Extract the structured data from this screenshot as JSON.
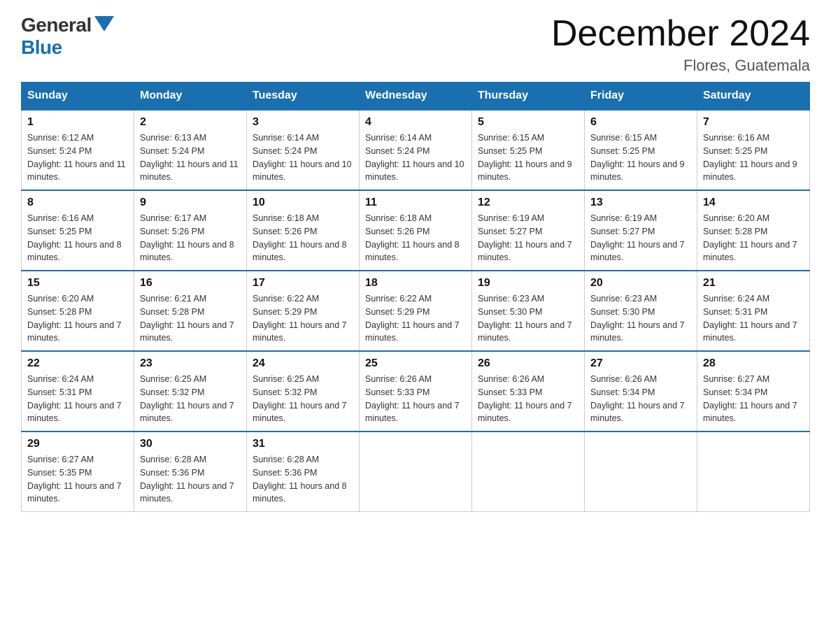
{
  "header": {
    "logo_general": "General",
    "logo_blue": "Blue",
    "month_year": "December 2024",
    "location": "Flores, Guatemala"
  },
  "weekdays": [
    "Sunday",
    "Monday",
    "Tuesday",
    "Wednesday",
    "Thursday",
    "Friday",
    "Saturday"
  ],
  "weeks": [
    [
      {
        "day": "1",
        "sunrise": "6:12 AM",
        "sunset": "5:24 PM",
        "daylight": "11 hours and 11 minutes."
      },
      {
        "day": "2",
        "sunrise": "6:13 AM",
        "sunset": "5:24 PM",
        "daylight": "11 hours and 11 minutes."
      },
      {
        "day": "3",
        "sunrise": "6:14 AM",
        "sunset": "5:24 PM",
        "daylight": "11 hours and 10 minutes."
      },
      {
        "day": "4",
        "sunrise": "6:14 AM",
        "sunset": "5:24 PM",
        "daylight": "11 hours and 10 minutes."
      },
      {
        "day": "5",
        "sunrise": "6:15 AM",
        "sunset": "5:25 PM",
        "daylight": "11 hours and 9 minutes."
      },
      {
        "day": "6",
        "sunrise": "6:15 AM",
        "sunset": "5:25 PM",
        "daylight": "11 hours and 9 minutes."
      },
      {
        "day": "7",
        "sunrise": "6:16 AM",
        "sunset": "5:25 PM",
        "daylight": "11 hours and 9 minutes."
      }
    ],
    [
      {
        "day": "8",
        "sunrise": "6:16 AM",
        "sunset": "5:25 PM",
        "daylight": "11 hours and 8 minutes."
      },
      {
        "day": "9",
        "sunrise": "6:17 AM",
        "sunset": "5:26 PM",
        "daylight": "11 hours and 8 minutes."
      },
      {
        "day": "10",
        "sunrise": "6:18 AM",
        "sunset": "5:26 PM",
        "daylight": "11 hours and 8 minutes."
      },
      {
        "day": "11",
        "sunrise": "6:18 AM",
        "sunset": "5:26 PM",
        "daylight": "11 hours and 8 minutes."
      },
      {
        "day": "12",
        "sunrise": "6:19 AM",
        "sunset": "5:27 PM",
        "daylight": "11 hours and 7 minutes."
      },
      {
        "day": "13",
        "sunrise": "6:19 AM",
        "sunset": "5:27 PM",
        "daylight": "11 hours and 7 minutes."
      },
      {
        "day": "14",
        "sunrise": "6:20 AM",
        "sunset": "5:28 PM",
        "daylight": "11 hours and 7 minutes."
      }
    ],
    [
      {
        "day": "15",
        "sunrise": "6:20 AM",
        "sunset": "5:28 PM",
        "daylight": "11 hours and 7 minutes."
      },
      {
        "day": "16",
        "sunrise": "6:21 AM",
        "sunset": "5:28 PM",
        "daylight": "11 hours and 7 minutes."
      },
      {
        "day": "17",
        "sunrise": "6:22 AM",
        "sunset": "5:29 PM",
        "daylight": "11 hours and 7 minutes."
      },
      {
        "day": "18",
        "sunrise": "6:22 AM",
        "sunset": "5:29 PM",
        "daylight": "11 hours and 7 minutes."
      },
      {
        "day": "19",
        "sunrise": "6:23 AM",
        "sunset": "5:30 PM",
        "daylight": "11 hours and 7 minutes."
      },
      {
        "day": "20",
        "sunrise": "6:23 AM",
        "sunset": "5:30 PM",
        "daylight": "11 hours and 7 minutes."
      },
      {
        "day": "21",
        "sunrise": "6:24 AM",
        "sunset": "5:31 PM",
        "daylight": "11 hours and 7 minutes."
      }
    ],
    [
      {
        "day": "22",
        "sunrise": "6:24 AM",
        "sunset": "5:31 PM",
        "daylight": "11 hours and 7 minutes."
      },
      {
        "day": "23",
        "sunrise": "6:25 AM",
        "sunset": "5:32 PM",
        "daylight": "11 hours and 7 minutes."
      },
      {
        "day": "24",
        "sunrise": "6:25 AM",
        "sunset": "5:32 PM",
        "daylight": "11 hours and 7 minutes."
      },
      {
        "day": "25",
        "sunrise": "6:26 AM",
        "sunset": "5:33 PM",
        "daylight": "11 hours and 7 minutes."
      },
      {
        "day": "26",
        "sunrise": "6:26 AM",
        "sunset": "5:33 PM",
        "daylight": "11 hours and 7 minutes."
      },
      {
        "day": "27",
        "sunrise": "6:26 AM",
        "sunset": "5:34 PM",
        "daylight": "11 hours and 7 minutes."
      },
      {
        "day": "28",
        "sunrise": "6:27 AM",
        "sunset": "5:34 PM",
        "daylight": "11 hours and 7 minutes."
      }
    ],
    [
      {
        "day": "29",
        "sunrise": "6:27 AM",
        "sunset": "5:35 PM",
        "daylight": "11 hours and 7 minutes."
      },
      {
        "day": "30",
        "sunrise": "6:28 AM",
        "sunset": "5:36 PM",
        "daylight": "11 hours and 7 minutes."
      },
      {
        "day": "31",
        "sunrise": "6:28 AM",
        "sunset": "5:36 PM",
        "daylight": "11 hours and 8 minutes."
      },
      null,
      null,
      null,
      null
    ]
  ]
}
